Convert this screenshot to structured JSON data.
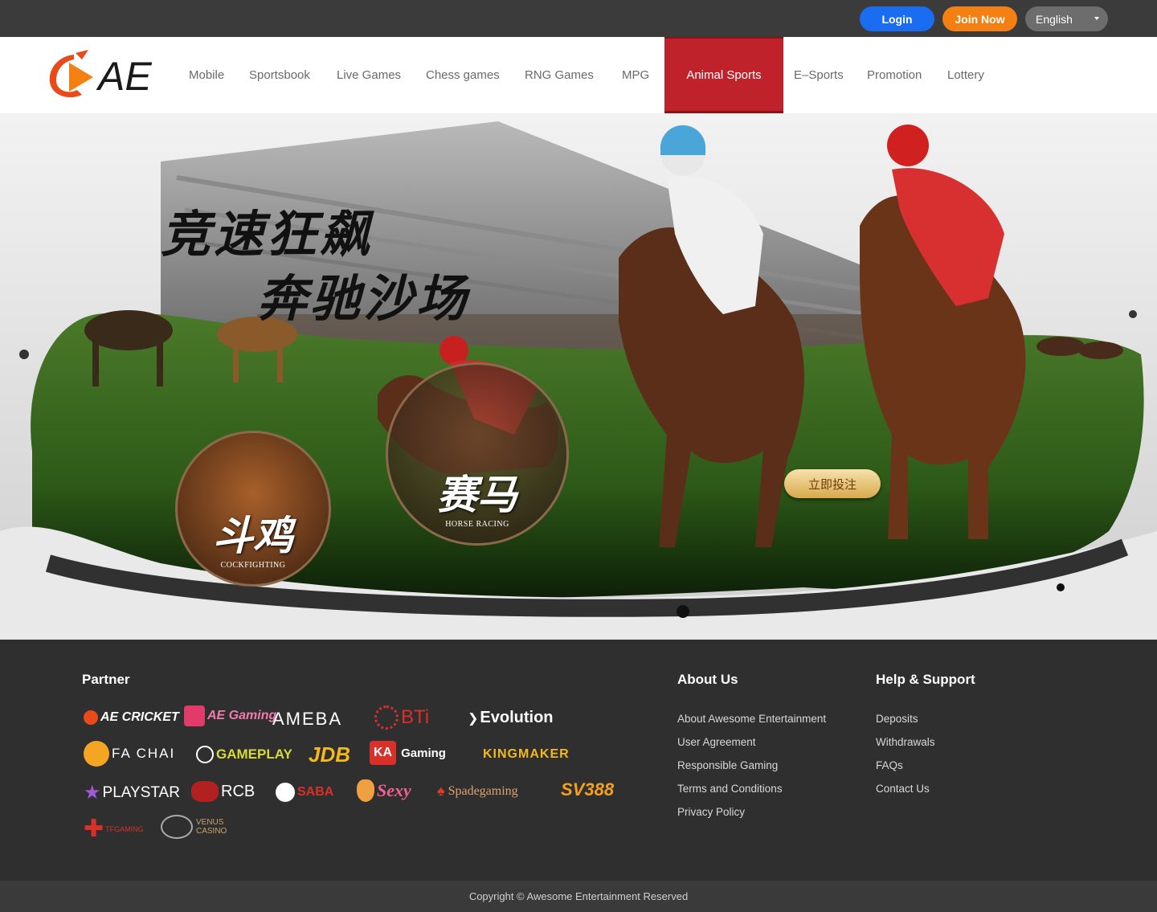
{
  "topbar": {
    "login_label": "Login",
    "join_label": "Join Now",
    "language": "English"
  },
  "nav": {
    "logo_text": "AE",
    "items": [
      {
        "label": "Mobile"
      },
      {
        "label": "Sportsbook"
      },
      {
        "label": "Live Games"
      },
      {
        "label": "Chess games"
      },
      {
        "label": "RNG Games"
      },
      {
        "label": "MPG"
      },
      {
        "label": "Animal Sports",
        "active": true
      },
      {
        "label": "E–Sports"
      },
      {
        "label": "Promotion"
      },
      {
        "label": "Lottery"
      }
    ],
    "active_color": "#c0222b"
  },
  "banner": {
    "headline_line1": "竞速狂飙",
    "headline_line2": "奔驰沙场",
    "badge_cockfight_cn": "斗鸡",
    "badge_cockfight_en": "COCKFIGHTING",
    "badge_horse_cn": "赛马",
    "badge_horse_en": "HORSE RACING",
    "bet_button": "立即投注"
  },
  "footer": {
    "partner_heading": "Partner",
    "partners": [
      "AE CRICKET",
      "AE Gaming",
      "AMEBA",
      "BTi",
      "Evolution",
      "FA CHAI",
      "GAMEPLAY",
      "JDB",
      "KA",
      "Gaming",
      "KINGMAKER",
      "PLAYSTAR",
      "RCB",
      "SABA",
      "Sexy",
      "Spadegaming",
      "SV388",
      "TFGAMING",
      "VENUS",
      "CASINO"
    ],
    "about_heading": "About Us",
    "about_links": [
      "About Awesome Entertainment",
      "User Agreement",
      "Responsible Gaming",
      "Terms and Conditions",
      "Privacy Policy"
    ],
    "help_heading": "Help & Support",
    "help_links": [
      "Deposits",
      "Withdrawals",
      "FAQs",
      "Contact Us"
    ],
    "copyright": "Copyright © Awesome Entertainment Reserved"
  },
  "colors": {
    "login": "#1a6cf0",
    "join": "#f47f13",
    "footer_bg": "#2f2f2f"
  }
}
